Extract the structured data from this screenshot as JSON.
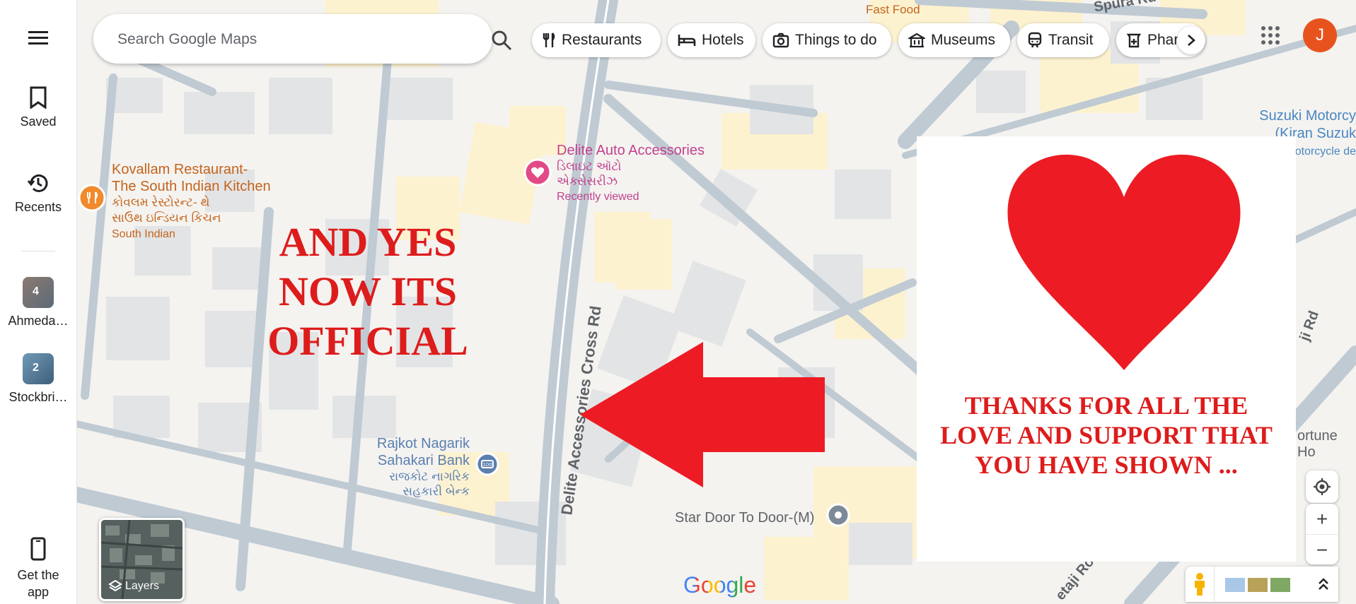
{
  "rail": {
    "saved_label": "Saved",
    "recents_label": "Recents",
    "recent_places": [
      {
        "label": "Ahmeda…",
        "count": "4"
      },
      {
        "label": "Stockbri…",
        "count": "2"
      }
    ],
    "get_app_label": "Get the app"
  },
  "search": {
    "placeholder": "Search Google Maps"
  },
  "chips": [
    "Restaurants",
    "Hotels",
    "Things to do",
    "Museums",
    "Transit",
    "Phar"
  ],
  "account": {
    "initial": "J",
    "color": "#e8531d"
  },
  "map_labels": {
    "fast_food": "Fast Food",
    "kovallam_line1": "Kovallam Restaurant-",
    "kovallam_line2": "The South Indian Kitchen",
    "kovallam_gu1": "કોવલમ રેસ્ટોરન્ટ- થે",
    "kovallam_gu2": "સાઉથ ઇન્ડિયન કિચન",
    "kovallam_type": "South Indian",
    "delite_line1": "Delite Auto Accessories",
    "delite_gu1": "ડિલાઇટ ઑટો",
    "delite_gu2": "એક્સેસરીઝ",
    "delite_note": "Recently viewed",
    "bank_line1": "Rajkot Nagarik",
    "bank_line2": "Sahakari Bank",
    "bank_gu1": "રાજકોટ નાગરિક",
    "bank_gu2": "સહકારી બેન્ક",
    "star_door": "Star Door To Door-(M)",
    "road_cross": "Delite Accessories Cross Rd",
    "suzuki_line1": "Suzuki Motorcy",
    "suzuki_line2": "(Kiran Suzuk",
    "suzuki_line3": "otorcycle de",
    "fortune": "ortune Ho",
    "road_top": "Spura Rd",
    "road_right": "ji Rd",
    "road_bottom": "etaji Ro"
  },
  "overlay": {
    "left_line1": "AND YES",
    "left_line2": "NOW ITS",
    "left_line3": "OFFICIAL",
    "right_line1": "THANKS FOR ALL THE",
    "right_line2": "LOVE AND SUPPORT THAT",
    "right_line3": "YOU HAVE SHOWN ...",
    "accent": "#dd1c1c"
  },
  "layers_label": "Layers",
  "zoom": {
    "in": "+",
    "out": "−"
  },
  "logo": "Google"
}
